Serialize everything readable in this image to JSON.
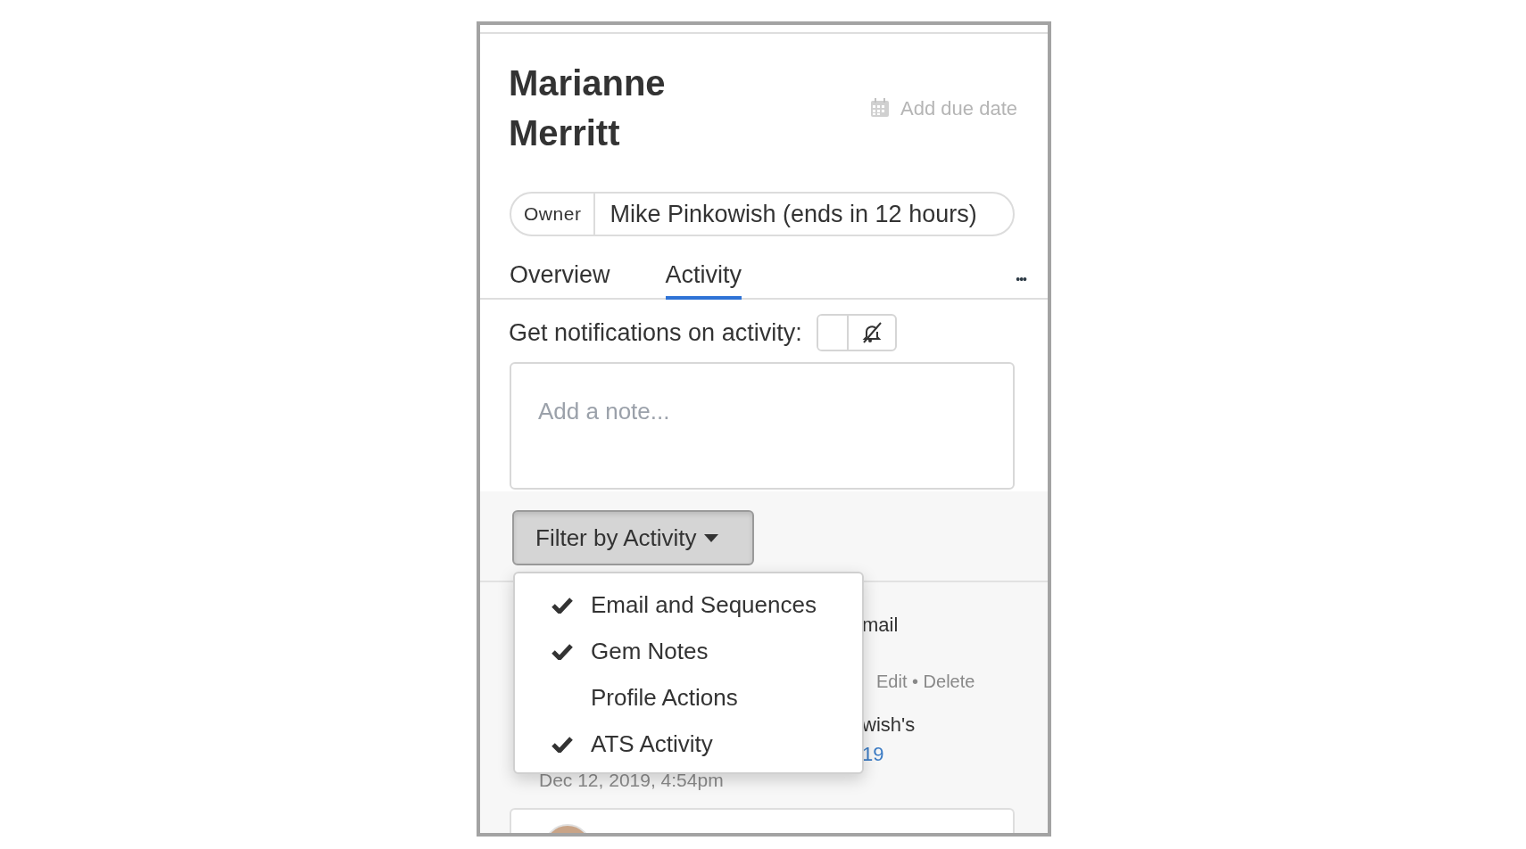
{
  "profile": {
    "name": "Marianne Merritt",
    "due_date_label": "Add due date"
  },
  "owner": {
    "label": "Owner",
    "value": "Mike Pinkowish (ends in 12 hours)"
  },
  "tabs": [
    {
      "label": "Overview",
      "selected": false
    },
    {
      "label": "Activity",
      "selected": true
    }
  ],
  "more_menu": "•••",
  "notifications": {
    "label": "Get notifications on activity:",
    "on": false
  },
  "note": {
    "placeholder": "Add a note..."
  },
  "filter": {
    "label": "Filter by Activity",
    "expanded": true,
    "options": [
      {
        "label": "Email and Sequences",
        "checked": true
      },
      {
        "label": "Gem Notes",
        "checked": true
      },
      {
        "label": "Profile Actions",
        "checked": false
      },
      {
        "label": "ATS Activity",
        "checked": true
      }
    ]
  },
  "activity_item": {
    "title_fragment": "mail",
    "actions": "Edit • Delete",
    "body_fragment": "wish's",
    "link_fragment": "19",
    "timestamp": "Dec 12, 2019, 4:54pm"
  }
}
